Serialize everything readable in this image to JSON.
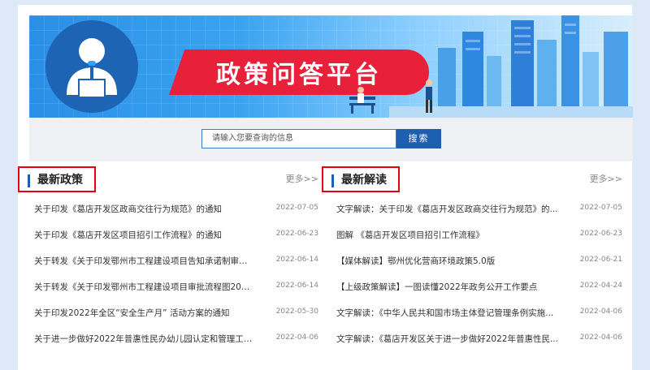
{
  "banner": {
    "title": "政策问答平台"
  },
  "search": {
    "placeholder": "请输入您要查询的信息",
    "button": "搜索"
  },
  "colors": {
    "brand_blue": "#1f5fb1",
    "highlight_red": "#e60012",
    "banner_red": "#e8203a"
  },
  "latest_policy": {
    "title": "最新政策",
    "more": "更多>>",
    "items": [
      {
        "title": "关于印发《葛店开发区政商交往行为规范》的通知",
        "date": "2022-07-05"
      },
      {
        "title": "关于印发《葛店开发区项目招引工作流程》的通知",
        "date": "2022-06-23"
      },
      {
        "title": "关于转发《关于印发鄂州市工程建设项目告知承诺制审批...",
        "date": "2022-06-14"
      },
      {
        "title": "关于转发《关于印发鄂州市工程建设项目审批流程图2022...",
        "date": "2022-06-14"
      },
      {
        "title": "关于印发2022年全区“安全生产月” 活动方案的通知",
        "date": "2022-05-30"
      },
      {
        "title": "关于进一步做好2022年普惠性民办幼儿园认定和管理工作...",
        "date": "2022-04-06"
      }
    ]
  },
  "latest_interpretation": {
    "title": "最新解读",
    "more": "更多>>",
    "items": [
      {
        "title": "文字解读：关于印发《葛店开发区政商交往行为规范》的...",
        "date": "2022-07-05"
      },
      {
        "title": "图解 《葛店开发区项目招引工作流程》",
        "date": "2022-06-23"
      },
      {
        "title": "【媒体解读】鄂州优化营商环境政策5.0版",
        "date": "2022-06-21"
      },
      {
        "title": "【上级政策解读】一图读懂2022年政务公开工作要点",
        "date": "2022-04-24"
      },
      {
        "title": "文字解读：《中华人民共和国市场主体登记管理条例实施...",
        "date": "2022-04-06"
      },
      {
        "title": "文字解读：《葛店开发区关于进一步做好2022年普惠性民...",
        "date": "2022-04-06"
      }
    ]
  }
}
